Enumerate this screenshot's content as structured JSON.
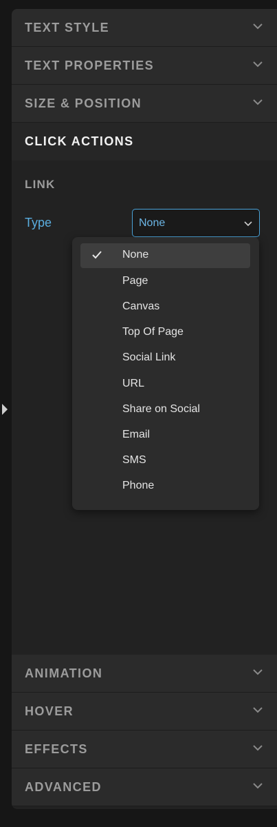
{
  "sections_top": [
    {
      "label": "TEXT STYLE"
    },
    {
      "label": "TEXT PROPERTIES"
    },
    {
      "label": "SIZE & POSITION"
    }
  ],
  "click_actions": {
    "title": "CLICK ACTIONS",
    "link": {
      "heading": "LINK",
      "type_label": "Type",
      "selected": "None",
      "options": [
        "None",
        "Page",
        "Canvas",
        "Top Of Page",
        "Social Link",
        "URL",
        "Share on Social",
        "Email",
        "SMS",
        "Phone"
      ]
    }
  },
  "sections_bottom": [
    {
      "label": "ANIMATION"
    },
    {
      "label": "HOVER"
    },
    {
      "label": "EFFECTS"
    },
    {
      "label": "ADVANCED"
    }
  ],
  "icons": {
    "collapse": "caret-right-icon",
    "section_toggle": "chevron-down-icon",
    "select_toggle": "chevron-down-icon",
    "selected_mark": "checkmark-icon"
  },
  "colors": {
    "panel_bg": "#222222",
    "header_bg": "#2b2b2b",
    "accent": "#4aa3d8",
    "muted_text": "#9c9c9c",
    "dropdown_bg": "#2c2c2c"
  }
}
